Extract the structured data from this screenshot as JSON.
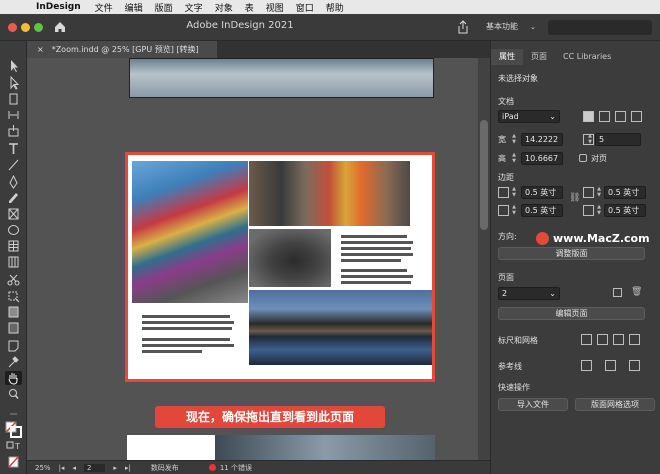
{
  "menubar": {
    "app_name": "InDesign",
    "items": [
      "文件",
      "编辑",
      "版面",
      "文字",
      "对象",
      "表",
      "视图",
      "窗口",
      "帮助"
    ]
  },
  "window": {
    "title": "Adobe InDesign 2021",
    "workspace": "基本功能"
  },
  "document_tab": {
    "close_glyph": "×",
    "label": "*Zoom.indd @ 25% [GPU 预览] [转换]"
  },
  "canvas": {
    "instruction_caption": "现在，确保拖出直到看到此页面"
  },
  "statusbar": {
    "zoom": "25%",
    "page": "2",
    "preflight_profile": "数码发布",
    "errors": "11 个错误"
  },
  "panel": {
    "tabs": [
      "属性",
      "页面",
      "CC Libraries"
    ],
    "selection": "未选择对象",
    "document_section": "文档",
    "preset": "iPad",
    "width_label": "宽",
    "width_value": "14.2222",
    "height_label": "高",
    "height_value": "10.6667",
    "pages_value": "5",
    "facing_pages_label": "对页",
    "margins_section": "边距",
    "margin_top": "0.5 英寸",
    "margin_inside": "0.5 英寸",
    "margin_bottom": "0.5 英寸",
    "margin_outside": "0.5 英寸",
    "orientation_label": "方向:",
    "adjust_layout_button": "调整版面",
    "page_section": "页面",
    "page_value": "2",
    "edit_page_button": "编辑页面",
    "rulers_grids_section": "标尺和网格",
    "guides_section": "参考线",
    "quick_actions_section": "快速操作",
    "import_file_button": "导入文件",
    "layout_grid_button": "版面网格选项"
  },
  "watermark": {
    "text": "www.MacZ.com"
  },
  "colors": {
    "accent_red": "#e5493c",
    "panel_bg": "#3c3c3c",
    "canvas_bg": "#535353"
  }
}
